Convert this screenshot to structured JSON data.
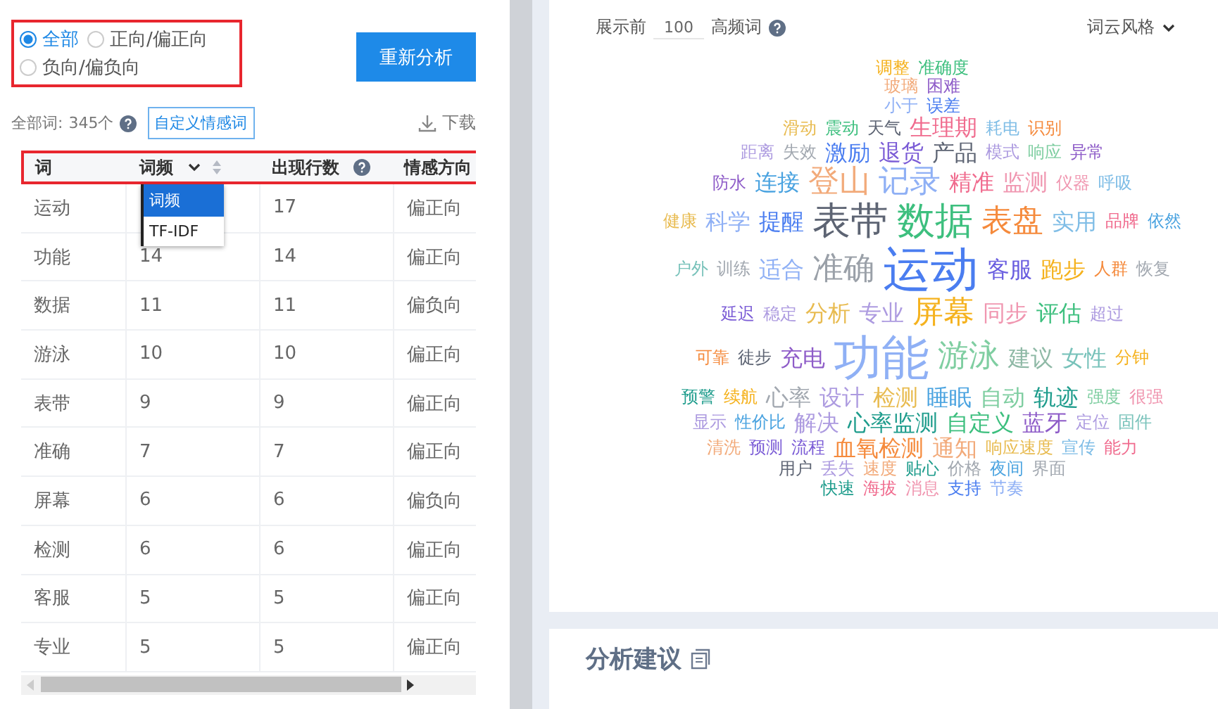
{
  "filter": {
    "options": [
      {
        "label": "全部",
        "selected": true
      },
      {
        "label": "正向/偏正向",
        "selected": false
      },
      {
        "label": "负向/偏负向",
        "selected": false
      }
    ]
  },
  "reanalyze_button": "重新分析",
  "summary": {
    "label": "全部词:",
    "count": "345个"
  },
  "custom_button": "自定义情感词",
  "download": "下载",
  "table": {
    "columns": [
      {
        "label": "词",
        "kind": "plain"
      },
      {
        "label": "词频",
        "kind": "select"
      },
      {
        "label": "出现行数",
        "kind": "help"
      },
      {
        "label": "情感方向",
        "kind": "plain"
      }
    ],
    "dropdown": {
      "options": [
        {
          "label": "词频",
          "selected": true
        },
        {
          "label": "TF-IDF",
          "selected": false
        }
      ]
    },
    "rows": [
      {
        "word": "运动",
        "count": "17",
        "sentiment": "偏正向"
      },
      {
        "word": "功能",
        "freq": "14",
        "count": "14",
        "sentiment": "偏正向"
      },
      {
        "word": "数据",
        "freq": "11",
        "count": "11",
        "sentiment": "偏负向"
      },
      {
        "word": "游泳",
        "freq": "10",
        "count": "10",
        "sentiment": "偏正向"
      },
      {
        "word": "表带",
        "freq": "9",
        "count": "9",
        "sentiment": "偏正向"
      },
      {
        "word": "准确",
        "freq": "7",
        "count": "7",
        "sentiment": "偏正向"
      },
      {
        "word": "屏幕",
        "freq": "6",
        "count": "6",
        "sentiment": "偏负向"
      },
      {
        "word": "检测",
        "freq": "6",
        "count": "6",
        "sentiment": "偏正向"
      },
      {
        "word": "客服",
        "freq": "5",
        "count": "5",
        "sentiment": "偏正向"
      },
      {
        "word": "专业",
        "freq": "5",
        "count": "5",
        "sentiment": "偏正向"
      }
    ]
  },
  "display": {
    "prefix": "展示前",
    "value": "100",
    "suffix": "高频词"
  },
  "style_menu": "词云风格",
  "word_cloud": {
    "lines": [
      {
        "words": [
          {
            "text": "调整",
            "color": "#f5b21e",
            "kind": "s"
          },
          {
            "text": "准确度",
            "color": "#3dbf7e",
            "kind": "s"
          }
        ]
      },
      {
        "words": [
          {
            "text": "玻璃",
            "color": "#f2aa7a",
            "kind": "s"
          },
          {
            "text": "困难",
            "color": "#8e5cc8",
            "kind": "s"
          }
        ]
      },
      {
        "words": [
          {
            "text": "小于",
            "color": "#8fb0f5",
            "kind": "s"
          },
          {
            "text": "误差",
            "color": "#4a7df0",
            "kind": "s"
          }
        ]
      },
      {
        "words": [
          {
            "text": "滑动",
            "color": "#e8bb50",
            "kind": "s"
          },
          {
            "text": "震动",
            "color": "#3dbf7e",
            "kind": "s"
          },
          {
            "text": "天气",
            "color": "#5d6473",
            "kind": "s"
          },
          {
            "text": "生理期",
            "color": "#f06b8e",
            "kind": "m"
          },
          {
            "text": "耗电",
            "color": "#7fbde6",
            "kind": "s"
          },
          {
            "text": "识别",
            "color": "#f58a3c",
            "kind": "s"
          }
        ]
      },
      {
        "words": [
          {
            "text": "距离",
            "color": "#ad9be0",
            "kind": "s"
          },
          {
            "text": "失效",
            "color": "#a2a8b0",
            "kind": "s"
          },
          {
            "text": "激励",
            "color": "#4a7df0",
            "kind": "m"
          },
          {
            "text": "退货",
            "color": "#7b5cd6",
            "kind": "m"
          },
          {
            "text": "产品",
            "color": "#5d6473",
            "kind": "m"
          },
          {
            "text": "模式",
            "color": "#ad9be0",
            "kind": "s"
          },
          {
            "text": "响应",
            "color": "#7fcea1",
            "kind": "s"
          },
          {
            "text": "异常",
            "color": "#8e5cc8",
            "kind": "s"
          }
        ]
      },
      {
        "words": [
          {
            "text": "防水",
            "color": "#8e5cc8",
            "kind": "s"
          },
          {
            "text": "连接",
            "color": "#4aa3e0",
            "kind": "m"
          },
          {
            "text": "登山",
            "color": "#f2aa7a",
            "kind": "ml"
          },
          {
            "text": "记录",
            "color": "#8fb0f5",
            "kind": "ml"
          },
          {
            "text": "精准",
            "color": "#f06b8e",
            "kind": "m"
          },
          {
            "text": "监测",
            "color": "#f096b0",
            "kind": "m"
          },
          {
            "text": "仪器",
            "color": "#f096b0",
            "kind": "s"
          },
          {
            "text": "呼吸",
            "color": "#7fbde6",
            "kind": "s"
          }
        ]
      },
      {
        "words": [
          {
            "text": "健康",
            "color": "#e8bb50",
            "kind": "s"
          },
          {
            "text": "科学",
            "color": "#8fb0f5",
            "kind": "m"
          },
          {
            "text": "提醒",
            "color": "#4a7df0",
            "kind": "m"
          },
          {
            "text": "表带",
            "color": "#5d6473",
            "kind": "l"
          },
          {
            "text": "数据",
            "color": "#3dbf7e",
            "kind": "l"
          },
          {
            "text": "表盘",
            "color": "#f58a3c",
            "kind": "ml"
          },
          {
            "text": "实用",
            "color": "#7fbde6",
            "kind": "m"
          },
          {
            "text": "品牌",
            "color": "#f06b8e",
            "kind": "s"
          },
          {
            "text": "依然",
            "color": "#4aa3e0",
            "kind": "s"
          }
        ]
      },
      {
        "words": [
          {
            "text": "户外",
            "color": "#78c2ba",
            "kind": "s"
          },
          {
            "text": "训练",
            "color": "#a2a8b0",
            "kind": "s"
          },
          {
            "text": "适合",
            "color": "#8fb0f5",
            "kind": "m"
          },
          {
            "text": "准确",
            "color": "#9aa0a8",
            "kind": "ml"
          },
          {
            "text": "运动",
            "color": "#4a7df0",
            "kind": "xl"
          },
          {
            "text": "客服",
            "color": "#6a5ee0",
            "kind": "m"
          },
          {
            "text": "跑步",
            "color": "#f5b21e",
            "kind": "m"
          },
          {
            "text": "人群",
            "color": "#f58a3c",
            "kind": "s"
          },
          {
            "text": "恢复",
            "color": "#a2a8b0",
            "kind": "s"
          }
        ]
      },
      {
        "words": [
          {
            "text": "延迟",
            "color": "#7b5cd6",
            "kind": "s"
          },
          {
            "text": "稳定",
            "color": "#ad9be0",
            "kind": "s"
          },
          {
            "text": "分析",
            "color": "#e8bb50",
            "kind": "m"
          },
          {
            "text": "专业",
            "color": "#ad9be0",
            "kind": "m"
          },
          {
            "text": "屏幕",
            "color": "#f5b21e",
            "kind": "ml"
          },
          {
            "text": "同步",
            "color": "#f096b0",
            "kind": "m"
          },
          {
            "text": "评估",
            "color": "#3dbf7e",
            "kind": "m"
          },
          {
            "text": "超过",
            "color": "#ad9be0",
            "kind": "s"
          }
        ]
      },
      {
        "words": [
          {
            "text": "可靠",
            "color": "#f58a3c",
            "kind": "s"
          },
          {
            "text": "徒步",
            "color": "#5d6473",
            "kind": "s"
          },
          {
            "text": "充电",
            "color": "#8e5cc8",
            "kind": "m"
          },
          {
            "text": "功能",
            "color": "#8fb0f5",
            "kind": "xl"
          },
          {
            "text": "游泳",
            "color": "#7fcea1",
            "kind": "ml"
          },
          {
            "text": "建议",
            "color": "#8fb9a6",
            "kind": "m"
          },
          {
            "text": "女性",
            "color": "#78c2ba",
            "kind": "m"
          },
          {
            "text": "分钟",
            "color": "#f5b21e",
            "kind": "s"
          }
        ]
      },
      {
        "words": [
          {
            "text": "预警",
            "color": "#1e9c8c",
            "kind": "s"
          },
          {
            "text": "续航",
            "color": "#f5b21e",
            "kind": "s"
          },
          {
            "text": "心率",
            "color": "#a2a8b0",
            "kind": "m"
          },
          {
            "text": "设计",
            "color": "#ad9be0",
            "kind": "m"
          },
          {
            "text": "检测",
            "color": "#e8bb50",
            "kind": "m"
          },
          {
            "text": "睡眠",
            "color": "#4aa3e0",
            "kind": "m"
          },
          {
            "text": "自动",
            "color": "#7fcea1",
            "kind": "m"
          },
          {
            "text": "轨迹",
            "color": "#1e9c8c",
            "kind": "m"
          },
          {
            "text": "强度",
            "color": "#7fcea1",
            "kind": "s"
          },
          {
            "text": "很强",
            "color": "#f096b0",
            "kind": "s"
          }
        ]
      },
      {
        "words": [
          {
            "text": "显示",
            "color": "#ad9be0",
            "kind": "s"
          },
          {
            "text": "性价比",
            "color": "#4aa3e0",
            "kind": "s"
          },
          {
            "text": "解决",
            "color": "#ad9be0",
            "kind": "m"
          },
          {
            "text": "心率监测",
            "color": "#1e9c8c",
            "kind": "m"
          },
          {
            "text": "自定义",
            "color": "#3dbf7e",
            "kind": "m"
          },
          {
            "text": "蓝牙",
            "color": "#8e5cc8",
            "kind": "m"
          },
          {
            "text": "定位",
            "color": "#ad9be0",
            "kind": "s"
          },
          {
            "text": "固件",
            "color": "#78c2ba",
            "kind": "s"
          }
        ]
      },
      {
        "words": [
          {
            "text": "清洗",
            "color": "#f2aa7a",
            "kind": "s"
          },
          {
            "text": "预测",
            "color": "#7b5cd6",
            "kind": "s"
          },
          {
            "text": "流程",
            "color": "#7b5cd6",
            "kind": "s"
          },
          {
            "text": "血氧检测",
            "color": "#f58a3c",
            "kind": "m"
          },
          {
            "text": "通知",
            "color": "#f2aa7a",
            "kind": "m"
          },
          {
            "text": "响应速度",
            "color": "#e8bb50",
            "kind": "s"
          },
          {
            "text": "宣传",
            "color": "#7fbde6",
            "kind": "s"
          },
          {
            "text": "能力",
            "color": "#f06b8e",
            "kind": "s"
          }
        ]
      },
      {
        "words": [
          {
            "text": "用户",
            "color": "#5d6473",
            "kind": "s"
          },
          {
            "text": "丢失",
            "color": "#ad9be0",
            "kind": "s"
          },
          {
            "text": "速度",
            "color": "#f2aa7a",
            "kind": "s"
          },
          {
            "text": "贴心",
            "color": "#1e9c8c",
            "kind": "s"
          },
          {
            "text": "价格",
            "color": "#a2a8b0",
            "kind": "s"
          },
          {
            "text": "夜间",
            "color": "#4aa3e0",
            "kind": "s"
          },
          {
            "text": "界面",
            "color": "#a2a8b0",
            "kind": "s"
          }
        ]
      },
      {
        "words": [
          {
            "text": "快速",
            "color": "#1e9c8c",
            "kind": "s"
          },
          {
            "text": "海拔",
            "color": "#f06b8e",
            "kind": "s"
          },
          {
            "text": "消息",
            "color": "#f096b0",
            "kind": "s"
          },
          {
            "text": "支持",
            "color": "#4a7df0",
            "kind": "s"
          },
          {
            "text": "节奏",
            "color": "#8fb0f5",
            "kind": "s"
          }
        ]
      }
    ]
  },
  "suggestion": {
    "title": "分析建议"
  }
}
